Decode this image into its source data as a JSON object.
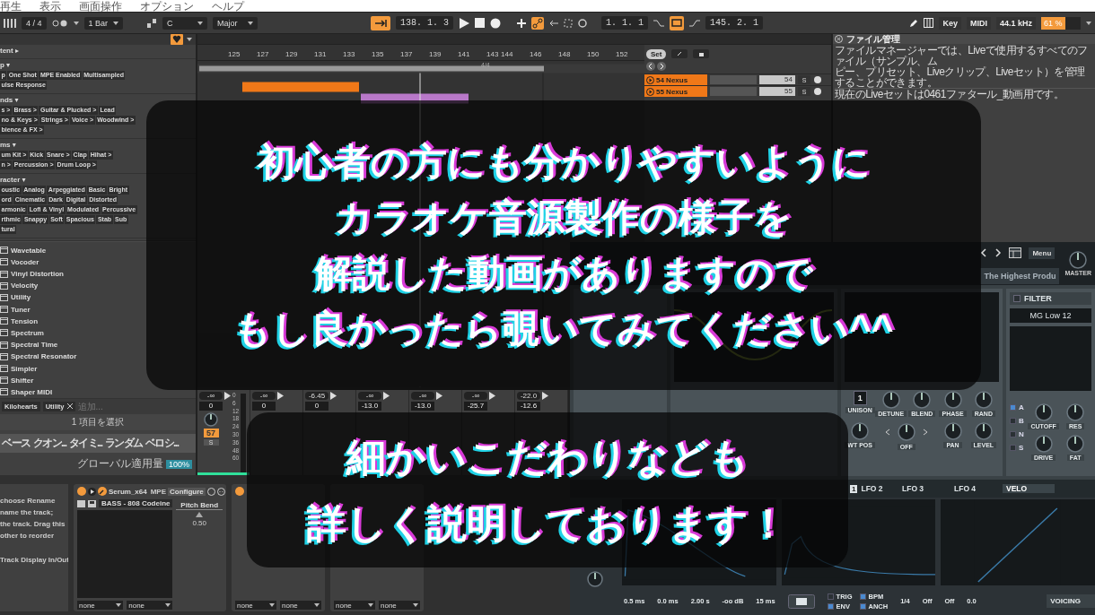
{
  "menu": [
    {
      "label": "再生"
    },
    {
      "label": "表示"
    },
    {
      "label": "画面操作"
    },
    {
      "label": "オプション"
    },
    {
      "label": "ヘルプ"
    }
  ],
  "toolbar": {
    "meter": "4 / 4",
    "quantize": "1 Bar",
    "key": "C",
    "scale": "Major",
    "position": "138. 1. 3",
    "loop_start": "1. 1. 1",
    "loop_length": "145. 2. 1",
    "key_button": "Key",
    "midi_button": "MIDI",
    "sample_rate": "44.1 kHz",
    "cpu": {
      "reading": "61 %",
      "level": 0.61
    }
  },
  "browser": {
    "tag_groups": [
      {
        "title": "tent ▸"
      },
      {
        "title": "p ▾",
        "rows": [
          {
            "tags": [
              "p",
              "One Shot",
              "MPE Enabled",
              "Multisampled"
            ]
          },
          {
            "tags": [
              "ulse Response"
            ]
          }
        ]
      },
      {
        "title": "nds ▾",
        "rows": [
          {
            "tags": [
              "s >",
              "Brass >",
              "Guitar & Plucked >",
              "Lead"
            ]
          },
          {
            "tags": [
              "no & Keys >",
              "Strings >",
              "Voice >",
              "Woodwind >"
            ]
          },
          {
            "tags": [
              "bience & FX >"
            ]
          }
        ]
      },
      {
        "title": "ms ▾",
        "rows": [
          {
            "tags": [
              "um Kit >",
              "Kick",
              "Snare >",
              "Clap",
              "Hihat >"
            ]
          },
          {
            "tags": [
              "n >",
              "Percussion >",
              "Drum Loop >"
            ]
          }
        ]
      },
      {
        "title": "racter ▾",
        "rows": [
          {
            "tags": [
              "oustic",
              "Analog",
              "Arpeggiated",
              "Basic",
              "Bright"
            ]
          },
          {
            "tags": [
              "ord",
              "Cinematic",
              "Dark",
              "Digital",
              "Distorted"
            ]
          },
          {
            "tags": [
              "armonic",
              "Lofi & Vinyl",
              "Modulated",
              "Percussive"
            ]
          },
          {
            "tags": [
              "rthmic",
              "Snappy",
              "Soft",
              "Spacious",
              "Stab",
              "Sub"
            ]
          },
          {
            "tags": [
              "tural"
            ]
          }
        ]
      }
    ],
    "devices": [
      "Wavetable",
      "Vocoder",
      "Vinyl Distortion",
      "Velocity",
      "Utility",
      "Tuner",
      "Tension",
      "Spectrum",
      "Spectral Time",
      "Spectral Resonator",
      "Simpler",
      "Shifter",
      "Shaper MIDI"
    ],
    "filter_tags": [
      "Kilohearts",
      "Utility"
    ],
    "filter_placeholder": "追加...",
    "selection": "1 項目を選択",
    "columns": [
      "ベース",
      "クオン...",
      "タイミ...",
      "ランダム",
      "ベロシ..."
    ],
    "global_label": "グローバル適用量",
    "global_value": "100%"
  },
  "arrangement": {
    "ruler": [
      "125",
      "127",
      "129",
      "131",
      "133",
      "135",
      "137",
      "139",
      "141",
      "143",
      "144",
      "146",
      "148",
      "150",
      "152"
    ],
    "time_signature": "4/4",
    "set_button": "Set",
    "tracks": [
      {
        "name": "54 Nexus",
        "number": "54",
        "solo": "S",
        "color": "#f07818"
      },
      {
        "name": "55 Nexus",
        "number": "55",
        "solo": "S",
        "color": "#f07818"
      }
    ]
  },
  "file_manager": {
    "title": "ファイル管理",
    "lines": [
      "ファイルマネージャーでは、Liveで使用するすべてのファイル（サンプル、ム",
      "ピー、プリセット、Liveクリップ、Liveセット）を管理することができます。"
    ],
    "current_set": "現在のLiveセットは0461ファタール_動画用です。"
  },
  "mixer": {
    "channels": [
      {
        "peak": "-∞",
        "volume": "0",
        "number": "57",
        "solo": "S",
        "color": "#30e09a",
        "scale": [
          "0",
          "6",
          "12",
          "18",
          "24",
          "30",
          "36",
          "48",
          "60"
        ]
      },
      {
        "peak": "-∞",
        "volume": "0"
      },
      {
        "peak": "-6.45",
        "volume": "0"
      },
      {
        "peak": "-∞",
        "volume": "-13.0"
      },
      {
        "peak": "-∞",
        "volume": "-13.0"
      },
      {
        "peak": "-∞",
        "volume": "-25.7"
      },
      {
        "peak": "-22.0",
        "volume": "-12.6"
      }
    ]
  },
  "device_chain": {
    "info_lines": [
      "choose Rename",
      "name the track;",
      "the track. Drag this",
      "other to reorder",
      "Track Display In/Out"
    ],
    "devices": [
      {
        "name": "Serum_x64",
        "on": true,
        "mpe": "MPE",
        "configure": "Configure",
        "preset": "BASS - 808 Codeine",
        "param": "Pitch Bend",
        "param_value": "0.50",
        "inputs": [
          "none",
          "none"
        ]
      },
      {
        "on": true,
        "inputs": [
          "none",
          "none"
        ]
      },
      {
        "inputs": [
          "none",
          "none"
        ]
      }
    ]
  },
  "synth": {
    "author": "The Highest Produ",
    "menu_button": "Menu",
    "master_label": "MASTER",
    "osc_controls": [
      {
        "kind": "spinner",
        "label": "UNISON",
        "value": "1"
      },
      {
        "kind": "knob",
        "label": "DETUNE"
      },
      {
        "kind": "knob",
        "label": "BLEND"
      },
      {
        "kind": "knob",
        "label": "PHASE"
      },
      {
        "kind": "knob",
        "label": "RAND"
      },
      {
        "kind": "knob",
        "label": "WT POS"
      },
      {
        "kind": "selector",
        "label": "OFF"
      },
      {
        "kind": "knob",
        "label": "PAN"
      },
      {
        "kind": "knob",
        "label": "LEVEL"
      }
    ],
    "filter": {
      "title": "FILTER",
      "type": "MG Low 12",
      "routes": [
        {
          "label": "A",
          "checked": true
        },
        {
          "label": "B",
          "checked": false
        },
        {
          "label": "N",
          "checked": false
        },
        {
          "label": "S",
          "checked": false
        }
      ],
      "controls": [
        "CUTOFF",
        "RES",
        "DRIVE",
        "FAT"
      ]
    },
    "mod_tabs": [
      {
        "label": "LFO 2",
        "badge": "1",
        "selected": false
      },
      {
        "label": "LFO 3",
        "selected": false
      },
      {
        "label": "LFO 4",
        "selected": false
      },
      {
        "label": "VELO",
        "selected": true
      }
    ],
    "env_values": [
      "0.5 ms",
      "0.0 ms",
      "2.00 s",
      "-oo dB",
      "15 ms"
    ],
    "lfo_switches": [
      {
        "label": "TRIG",
        "on": false
      },
      {
        "label": "BPM",
        "on": true
      },
      {
        "label": "ENV",
        "on": true
      },
      {
        "label": "ANCH",
        "on": true
      }
    ],
    "lfo_values": [
      "1/4",
      "Off",
      "Off",
      "0.0"
    ],
    "voicing": "VOICING"
  },
  "captions": [
    {
      "lines": [
        "初心者の方にも分かりやすいように",
        "カラオケ音源製作の様子を",
        "解説した動画がありますので",
        "もし良かったら覗いてみてください^^"
      ]
    },
    {
      "lines": [
        "細かいこだわりなども",
        "詳しく説明しております！"
      ]
    }
  ]
}
